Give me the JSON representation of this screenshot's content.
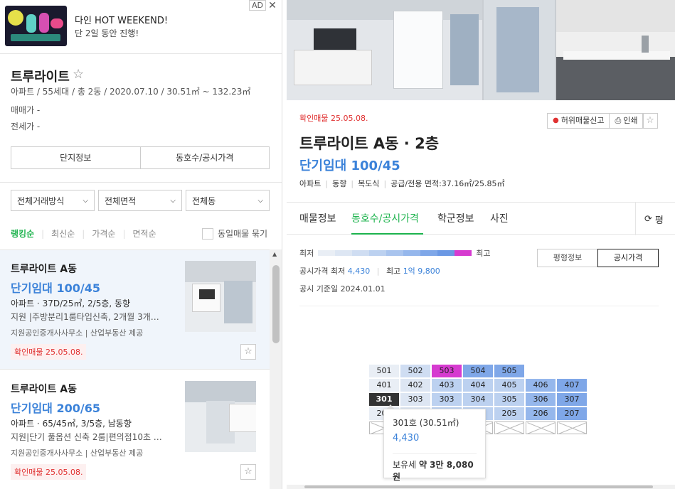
{
  "ad": {
    "title": "다인 HOT WEEKEND!",
    "subtitle": "단 2일 동안 진행!",
    "tag": "AD",
    "close": "✕"
  },
  "complex": {
    "name": "트루라이트",
    "info": "아파트 / 55세대 / 총 2동 / 2020.07.10 / 30.51㎡ ~ 132.23㎡",
    "sale": "매매가 -",
    "jeonse": "전세가 -",
    "btn_info": "단지정보",
    "btn_units": "동호수/공시가격"
  },
  "filters": [
    "전체거래방식",
    "전체면적",
    "전체동"
  ],
  "sorts": [
    "랭킹순",
    "최신순",
    "가격순",
    "면적순"
  ],
  "same_listing": "동일매물 묶기",
  "listings": [
    {
      "name": "트루라이트 A동",
      "price": "단기임대 100/45",
      "spec": "아파트 · 37D/25㎡, 2/5층, 동향",
      "desc": "지원 |주방분리1룸타입신축, 2개월 3개…",
      "agent": "지원공인중개사사무소 | 산업부동산 제공",
      "badge": "확인매물 25.05.08."
    },
    {
      "name": "트루라이트 A동",
      "price": "단기임대 200/65",
      "spec": "아파트 · 65/45㎡, 3/5층, 남동향",
      "desc": "지원|단기 풀옵션 신축 2룸|편의점10초 …",
      "agent": "지원공인중개사사무소 | 산업부동산 제공",
      "badge": "확인매물 25.05.08."
    }
  ],
  "detail": {
    "badge": "확인매물 25.05.08.",
    "report": "허위매물신고",
    "print": "인쇄",
    "title": "트루라이트 A동 · 2층",
    "price": "단기임대 100/45",
    "spec": [
      "아파트",
      "동향",
      "복도식",
      "공급/전용 면적:37.16㎡/25.85㎡"
    ],
    "tabs": [
      "매물정보",
      "동호수/공시가격",
      "학군정보",
      "사진"
    ],
    "tab_more": "평"
  },
  "price_panel": {
    "legend_low": "최저",
    "legend_high": "최고",
    "scale_colors": [
      "#e9eef5",
      "#dde6f3",
      "#cfddf2",
      "#bcd1f0",
      "#a9c4ee",
      "#95b7ec",
      "#7fa7e8",
      "#6b98e4",
      "#d63bd0"
    ],
    "min_label": "공시가격 최저",
    "min_value": "4,430",
    "max_label": "최고",
    "max_value": "1억 9,800",
    "base_date": "공시 기준일  2024.01.01",
    "toggle": [
      "평형정보",
      "공시가격"
    ]
  },
  "grid": {
    "rows": [
      [
        {
          "t": "501",
          "c": "#e9eef5"
        },
        {
          "t": "502",
          "c": "#cfddf2"
        },
        {
          "t": "503",
          "c": "#d63bd0"
        },
        {
          "t": "504",
          "c": "#7fa7e8"
        },
        {
          "t": "505",
          "c": "#7fa7e8"
        },
        null,
        null
      ],
      [
        {
          "t": "401",
          "c": "#e9eef5"
        },
        {
          "t": "402",
          "c": "#dde6f3"
        },
        {
          "t": "403",
          "c": "#bcd1f0"
        },
        {
          "t": "404",
          "c": "#bcd1f0"
        },
        {
          "t": "405",
          "c": "#bcd1f0"
        },
        {
          "t": "406",
          "c": "#95b7ec"
        },
        {
          "t": "407",
          "c": "#7fa7e8"
        }
      ],
      [
        {
          "t": "301",
          "c": "#333333",
          "fg": "#ffffff"
        },
        {
          "t": "303",
          "c": "#dde6f3"
        },
        {
          "t": "303",
          "c": "#bcd1f0"
        },
        {
          "t": "304",
          "c": "#bcd1f0"
        },
        {
          "t": "305",
          "c": "#bcd1f0"
        },
        {
          "t": "306",
          "c": "#95b7ec"
        },
        {
          "t": "307",
          "c": "#7fa7e8"
        }
      ],
      [
        {
          "t": "201",
          "c": "#e9eef5"
        },
        {
          "t": "",
          "c": "#dde6f3"
        },
        {
          "t": "",
          "c": "#bcd1f0"
        },
        {
          "t": "",
          "c": "#bcd1f0"
        },
        {
          "t": "205",
          "c": "#bcd1f0"
        },
        {
          "t": "206",
          "c": "#95b7ec"
        },
        {
          "t": "207",
          "c": "#7fa7e8"
        }
      ],
      [
        {
          "t": "",
          "x": true
        },
        {
          "t": "",
          "x": true
        },
        {
          "t": "",
          "x": true
        },
        {
          "t": "",
          "x": true
        },
        {
          "t": "",
          "x": true
        },
        {
          "t": "",
          "x": true
        },
        {
          "t": "",
          "x": true
        }
      ]
    ]
  },
  "tooltip": {
    "unit": "301호 (30.51㎡)",
    "price": "4,430",
    "tax_label": "보유세",
    "tax_value": "약 3만 8,080원"
  }
}
